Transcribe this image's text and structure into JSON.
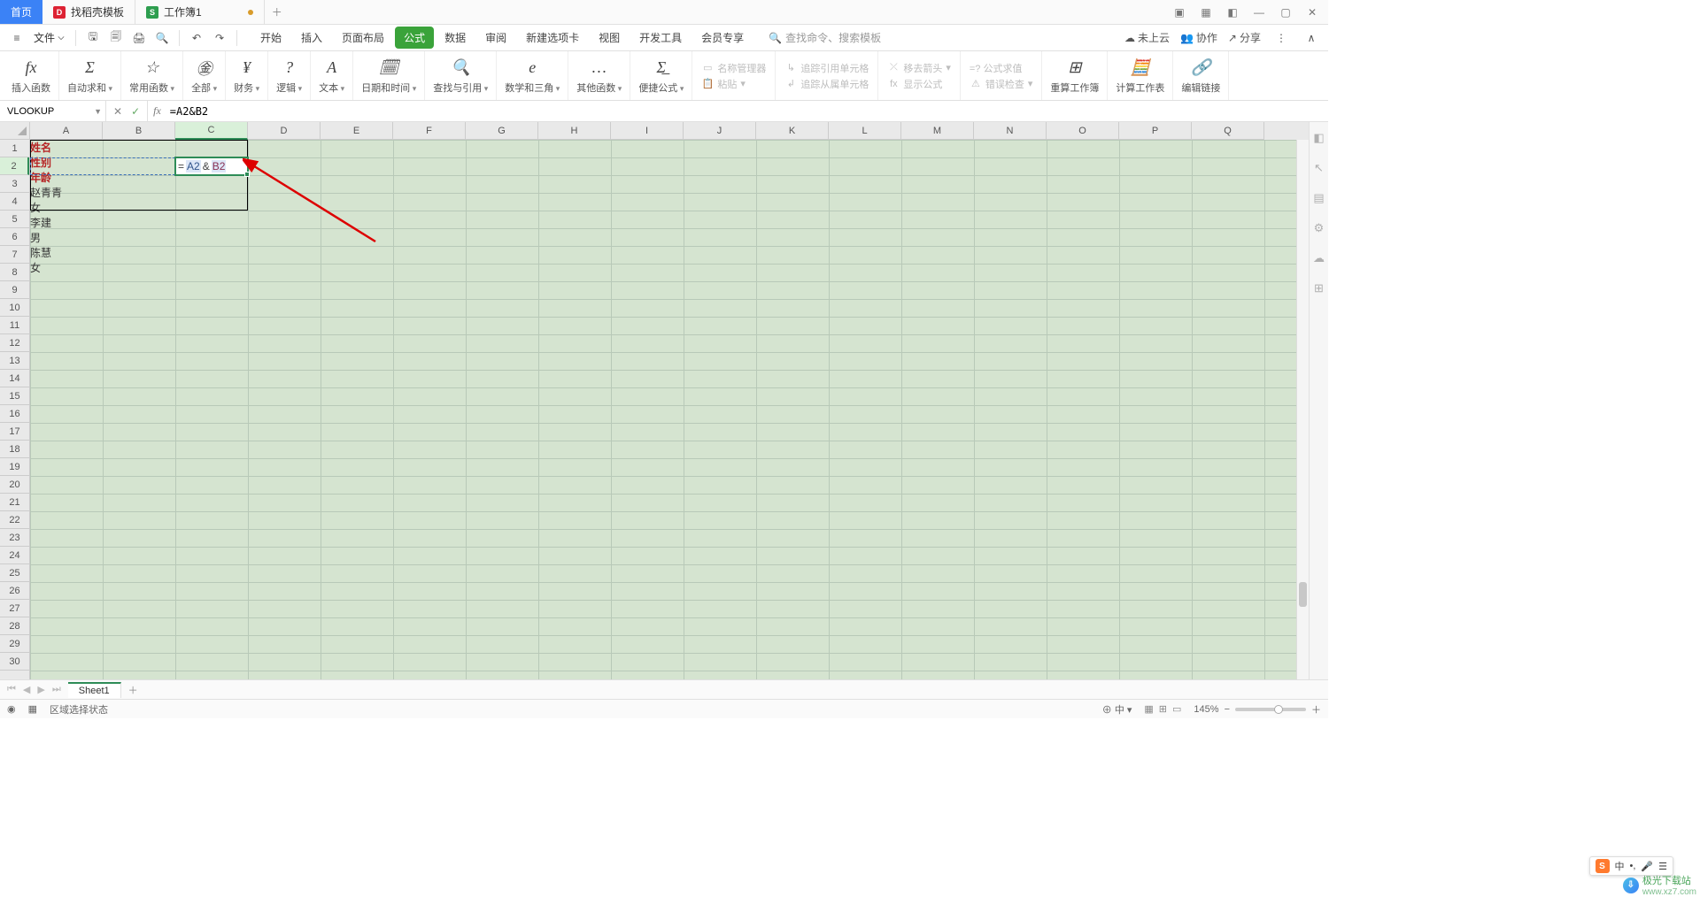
{
  "title_tabs": {
    "home": "首页",
    "doc1": "找稻壳模板",
    "doc2": "工作簿1"
  },
  "file_label": "文件",
  "menu_tabs": [
    "开始",
    "插入",
    "页面布局",
    "公式",
    "数据",
    "审阅",
    "新建选项卡",
    "视图",
    "开发工具",
    "会员专享"
  ],
  "menu_active_index": 3,
  "search_placeholder": "查找命令、搜索模板",
  "qat_right": {
    "cloud": "未上云",
    "coop": "协作",
    "share": "分享"
  },
  "ribbon_groups": [
    {
      "icon": "fx",
      "label": "插入函数"
    },
    {
      "icon": "Σ",
      "label": "自动求和",
      "drop": true
    },
    {
      "icon": "☆",
      "label": "常用函数",
      "drop": true
    },
    {
      "icon": "㊎",
      "label": "全部",
      "drop": true
    },
    {
      "icon": "¥",
      "label": "财务",
      "drop": true
    },
    {
      "icon": "?",
      "label": "逻辑",
      "drop": true
    },
    {
      "icon": "A",
      "label": "文本",
      "drop": true
    },
    {
      "icon": "🗓",
      "label": "日期和时间",
      "drop": true
    },
    {
      "icon": "🔍",
      "label": "查找与引用",
      "drop": true
    },
    {
      "icon": "e",
      "label": "数学和三角",
      "drop": true
    },
    {
      "icon": "…",
      "label": "其他函数",
      "drop": true
    },
    {
      "icon": "Σ̲",
      "label": "便捷公式",
      "drop": true
    }
  ],
  "ribbon_name": {
    "mgr": "名称管理器",
    "paste": "粘贴",
    "disabled": true
  },
  "ribbon_trace": {
    "a": "追踪引用单元格",
    "b": "追踪从属单元格",
    "disabled": true
  },
  "ribbon_trace2": {
    "a": "移去箭头",
    "b": "显示公式",
    "disabled": true
  },
  "ribbon_eval": {
    "a": "=? 公式求值",
    "b": "错误检查",
    "disabled": true
  },
  "ribbon_tail": [
    {
      "icon": "⊞",
      "label": "重算工作簿"
    },
    {
      "icon": "🧮",
      "label": "计算工作表"
    },
    {
      "icon": "🔗",
      "label": "编辑链接"
    }
  ],
  "name_box": "VLOOKUP",
  "formula_bar": "=A2&B2",
  "columns": [
    "A",
    "B",
    "C",
    "D",
    "E",
    "F",
    "G",
    "H",
    "I",
    "J",
    "K",
    "L",
    "M",
    "N",
    "O",
    "P",
    "Q"
  ],
  "sel_col_index": 2,
  "row_count": 30,
  "sel_row_index": 1,
  "table": {
    "headers": [
      "姓名",
      "性别",
      "年龄"
    ],
    "rows": [
      [
        "赵青青",
        "女"
      ],
      [
        "李建",
        "男"
      ],
      [
        "陈慧",
        "女"
      ]
    ]
  },
  "formula_display": {
    "prefix": "=",
    "a": "A2",
    "amp": "&",
    "b": "B2"
  },
  "sheet_tab": "Sheet1",
  "status_left": "区域选择状态",
  "status_ime": "中",
  "zoom": "145%",
  "watermark": {
    "brand": "极光下载站",
    "url": "www.xz7.com"
  },
  "ime": {
    "lang": "中"
  }
}
